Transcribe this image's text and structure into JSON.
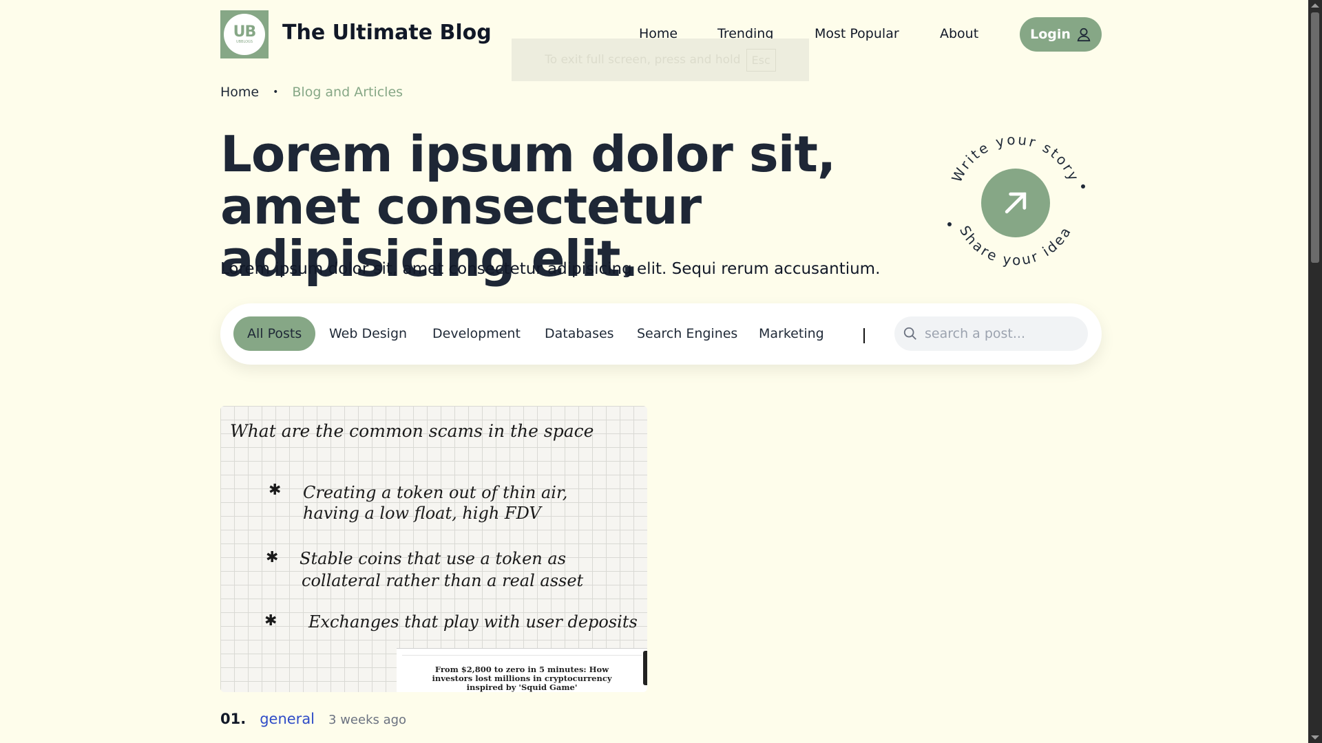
{
  "header": {
    "logo_text": "UB",
    "logo_sub": "UBBLOGS",
    "site_title": "The Ultimate Blog",
    "nav": [
      "Home",
      "Trending",
      "Most Popular",
      "About"
    ],
    "login_label": "Login",
    "login_icon": "user-icon"
  },
  "fullscreen_tip": {
    "text": "To exit full screen, press and hold",
    "key": "Esc"
  },
  "breadcrumb": {
    "home": "Home",
    "current": "Blog and Articles"
  },
  "hero": {
    "title": "Lorem ipsum dolor sit, amet consectetur adipisicing elit.",
    "subtitle": "Lorem ipsum dolor sit, amet consectetur adipisicing elit. Sequi rerum accusantium.",
    "badge_top": "Write your story",
    "badge_bottom": "Share your idea",
    "badge_icon": "arrow-up-right-icon"
  },
  "filters": {
    "items": [
      "All Posts",
      "Web Design",
      "Development",
      "Databases",
      "Search Engines",
      "Marketing"
    ],
    "active": "All Posts",
    "search_placeholder": "search a post...",
    "search_icon": "search-icon"
  },
  "post": {
    "number": "01.",
    "category": "general",
    "time": "3 weeks ago",
    "image_note": {
      "title": "What are the common scams in the space",
      "bullets": [
        [
          "Creating a token out of thin air,",
          "having a low float, high FDV"
        ],
        [
          "Stable coins that use a token as",
          "collateral rather than a real asset"
        ],
        [
          "Exchanges that play with user deposits"
        ]
      ],
      "news_headline": "From $2,800 to zero in 5 minutes: How investors lost millions in cryptocurrency inspired by 'Squid Game'"
    }
  },
  "colors": {
    "accent": "#86a786",
    "background": "#fefdeb",
    "link": "#2f4cc7"
  }
}
